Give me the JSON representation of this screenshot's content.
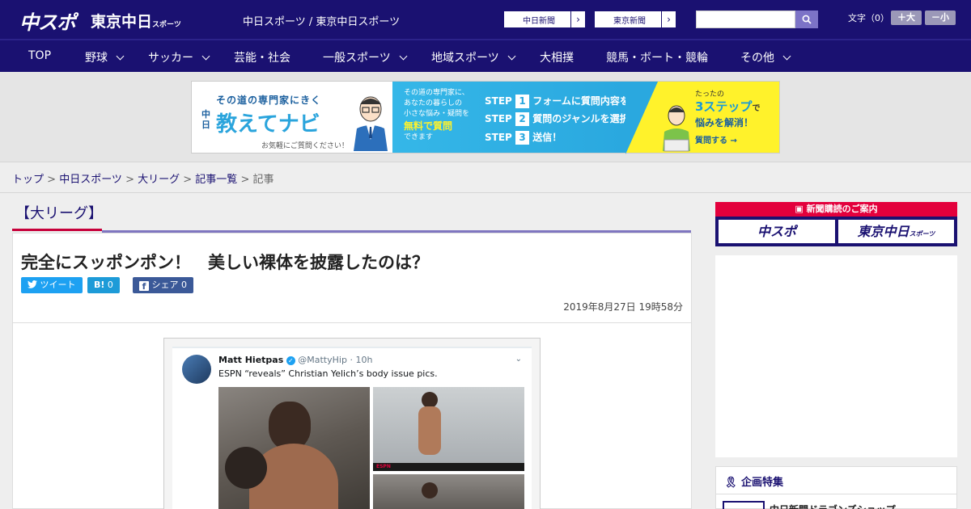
{
  "header": {
    "logo_chunichi": "中スポ",
    "logo_tokyo": "東京中日",
    "logo_tokyo_small": "スポーツ",
    "site_title": "中日スポーツ / 東京中日スポーツ",
    "paper_buttons": [
      "中日新聞",
      "東京新聞"
    ],
    "search_placeholder": "",
    "font_label": "文字（0）",
    "font_bigger": "＋大",
    "font_smaller": "－小"
  },
  "nav": {
    "items": [
      {
        "label": "TOP"
      },
      {
        "label": "野球"
      },
      {
        "label": "サッカー"
      },
      {
        "label": "芸能・社会"
      },
      {
        "label": "一般スポーツ"
      },
      {
        "label": "地域スポーツ"
      },
      {
        "label": "大相撲"
      },
      {
        "label": "競馬・ボート・競輪"
      },
      {
        "label": "その他"
      }
    ]
  },
  "banner": {
    "left_catch": "その道の専門家にきく",
    "left_brand_prefix": "中日",
    "left_brand": "教えてナビ",
    "left_sub": "お気軽にご質問ください！",
    "mid_text1": "その道の専門家に、",
    "mid_text2": "あなたの暮らしの",
    "mid_text3": "小さな悩み・疑問を",
    "mid_free": "無料で質問",
    "mid_text4": "できます",
    "steps": [
      {
        "step": "STEP",
        "num": "1",
        "text": "フォームに質問内容を入力"
      },
      {
        "step": "STEP",
        "num": "2",
        "text": "質問のジャンルを選択"
      },
      {
        "step": "STEP",
        "num": "3",
        "text": "送信！"
      }
    ],
    "right_top": "たったの",
    "right_big": "3ステップ",
    "right_de": "で",
    "right_solve": "悩みを解消！",
    "right_button": "質問する"
  },
  "breadcrumb": {
    "items": [
      "トップ",
      "中日スポーツ",
      "大リーグ",
      "記事一覧"
    ],
    "current": "記事",
    "sep": " > "
  },
  "article": {
    "category": "【大リーグ】",
    "headline": "完全にスッポンポン！　美しい裸体を披露したのは？",
    "tweet_label": "ツイート",
    "hatena_label": "B!",
    "hatena_count": "0",
    "share_label": "シェア",
    "share_count": "0",
    "date": "2019年8月27日 19時58分"
  },
  "tweet": {
    "name": "Matt Hietpas",
    "handle": "@MattyHip",
    "time": "· 10h",
    "text": "ESPN “reveals” Christian Yelich’s body issue pics.",
    "espn": "ESPN"
  },
  "sidebar": {
    "subscribe_title": "新聞購読のご案内",
    "subscribe_chunichi": "中スポ",
    "subscribe_tokyo": "東京中日",
    "subscribe_tokyo_small": "スポーツ",
    "kikaku_title": "企画特集",
    "kikaku_item": "中日新聞ドラゴンズショップ"
  }
}
